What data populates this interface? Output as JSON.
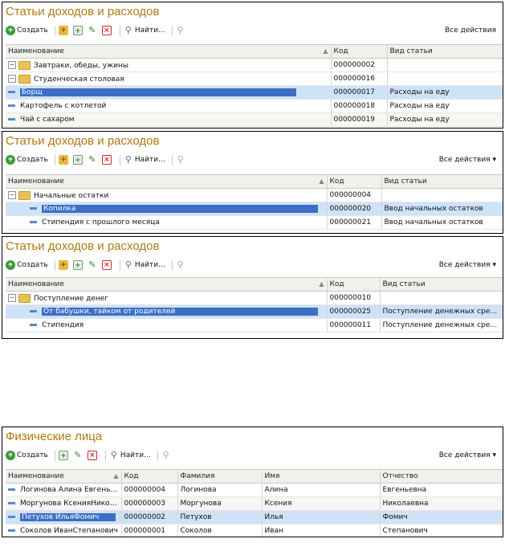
{
  "toolbar": {
    "create_label": "Создать",
    "find_label": "Найти...",
    "all_actions_label": "Все действия",
    "all_actions_suffix": "▾"
  },
  "panel1": {
    "title": "Статьи доходов и расходов",
    "columns": [
      "Наименование",
      "Код",
      "Вид статьи"
    ],
    "rows": [
      {
        "name": "Завтраки, обеды, ужины",
        "code": "000000002",
        "kind": ""
      },
      {
        "name": "Студенческая столовая",
        "code": "000000016",
        "kind": ""
      },
      {
        "name": "Борщ",
        "code": "000000017",
        "kind": "Расходы на еду"
      },
      {
        "name": "Картофель с котлетой",
        "code": "000000018",
        "kind": "Расходы на еду"
      },
      {
        "name": "Чай с сахаром",
        "code": "000000019",
        "kind": "Расходы на еду"
      }
    ]
  },
  "panel2": {
    "title": "Статьи доходов и расходов",
    "columns": [
      "Наименование",
      "Код",
      "Вид статьи"
    ],
    "rows": [
      {
        "name": "Начальные остатки",
        "code": "000000004",
        "kind": ""
      },
      {
        "name": "Копилка",
        "code": "000000020",
        "kind": "Ввод начальных остатков"
      },
      {
        "name": "Стипендия с прошлого месяца",
        "code": "000000021",
        "kind": "Ввод начальных остатков"
      }
    ]
  },
  "panel3": {
    "title": "Статьи доходов и расходов",
    "columns": [
      "Наименование",
      "Код",
      "Вид статьи"
    ],
    "rows": [
      {
        "name": "Поступление денег",
        "code": "000000010",
        "kind": ""
      },
      {
        "name": "От бабушки, тайком от родителей",
        "code": "000000025",
        "kind": "Поступление денежных средств"
      },
      {
        "name": "Стипендия",
        "code": "000000011",
        "kind": "Поступление денежных средств"
      }
    ]
  },
  "panel4": {
    "title": "Физические лица",
    "columns": [
      "Наименование",
      "Код",
      "Фамилия",
      "Имя",
      "Отчество"
    ],
    "rows": [
      {
        "name": "Логинова Алина Евгенье...",
        "code": "000000004",
        "last": "Логинова",
        "first": "Алина",
        "middle": "Евгеньевна"
      },
      {
        "name": "Моргунова КсенияНикол...",
        "code": "000000003",
        "last": "Моргунова",
        "first": "Ксения",
        "middle": "Николаевна"
      },
      {
        "name": "Петухов ИльяФомич",
        "code": "000000002",
        "last": "Петухов",
        "first": "Илья",
        "middle": "Фомич"
      },
      {
        "name": "Соколов ИванСтепанович",
        "code": "000000001",
        "last": "Соколов",
        "first": "Иван",
        "middle": "Степанович"
      }
    ]
  },
  "colors": {
    "title": "#b07a12",
    "selection_row": "#cfe3f7",
    "selection_cell": "#3c6fc4"
  }
}
